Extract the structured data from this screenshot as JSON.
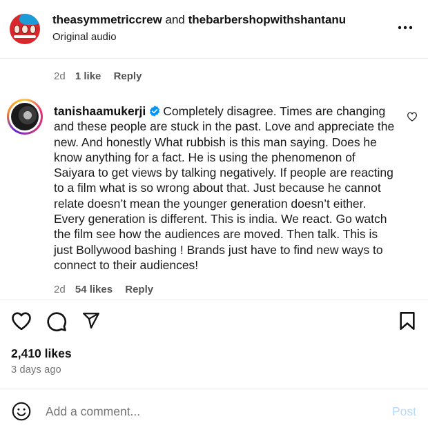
{
  "post_header": {
    "author_1": "theasymmetriccrew",
    "conjunction": "and",
    "author_2": "thebarbershopwithshantanu",
    "audio": "Original audio"
  },
  "previous_comment": {
    "age": "2d",
    "likes": "1 like",
    "reply": "Reply"
  },
  "comment": {
    "username": "tanishaamukerji",
    "verified": true,
    "text": "Completely disagree. Times are changing and these people are stuck in the past. Love and appreciate the new. And honestly What rubbish is this man saying. Does he know anything for a fact. He is using the phenomenon of Saiyara to get views by talking negatively. If people are reacting to a film what is so wrong about that. Just because he cannot relate doesn’t mean the younger generation doesn’t either. Every generation is different. This is india. We react. Go watch the film see how the audiences are moved. Then talk. This is just Bollywood bashing ! Brands just have to find new ways to connect to their audiences!",
    "age": "2d",
    "likes": "54 likes",
    "reply": "Reply"
  },
  "post_stats": {
    "likes": "2,410 likes",
    "time_ago": "3 days ago"
  },
  "composer": {
    "placeholder": "Add a comment...",
    "post_label": "Post"
  },
  "icons": {
    "more": "more-horizontal-icon",
    "like": "heart-icon",
    "comment": "comment-bubble-icon",
    "share": "paper-plane-icon",
    "save": "bookmark-icon",
    "emoji": "emoji-icon",
    "verified": "verified-badge-icon",
    "comment_like": "heart-icon"
  },
  "colors": {
    "verified": "#0095f6",
    "post_disabled": "#b3dbff",
    "meta_text": "#737373"
  }
}
